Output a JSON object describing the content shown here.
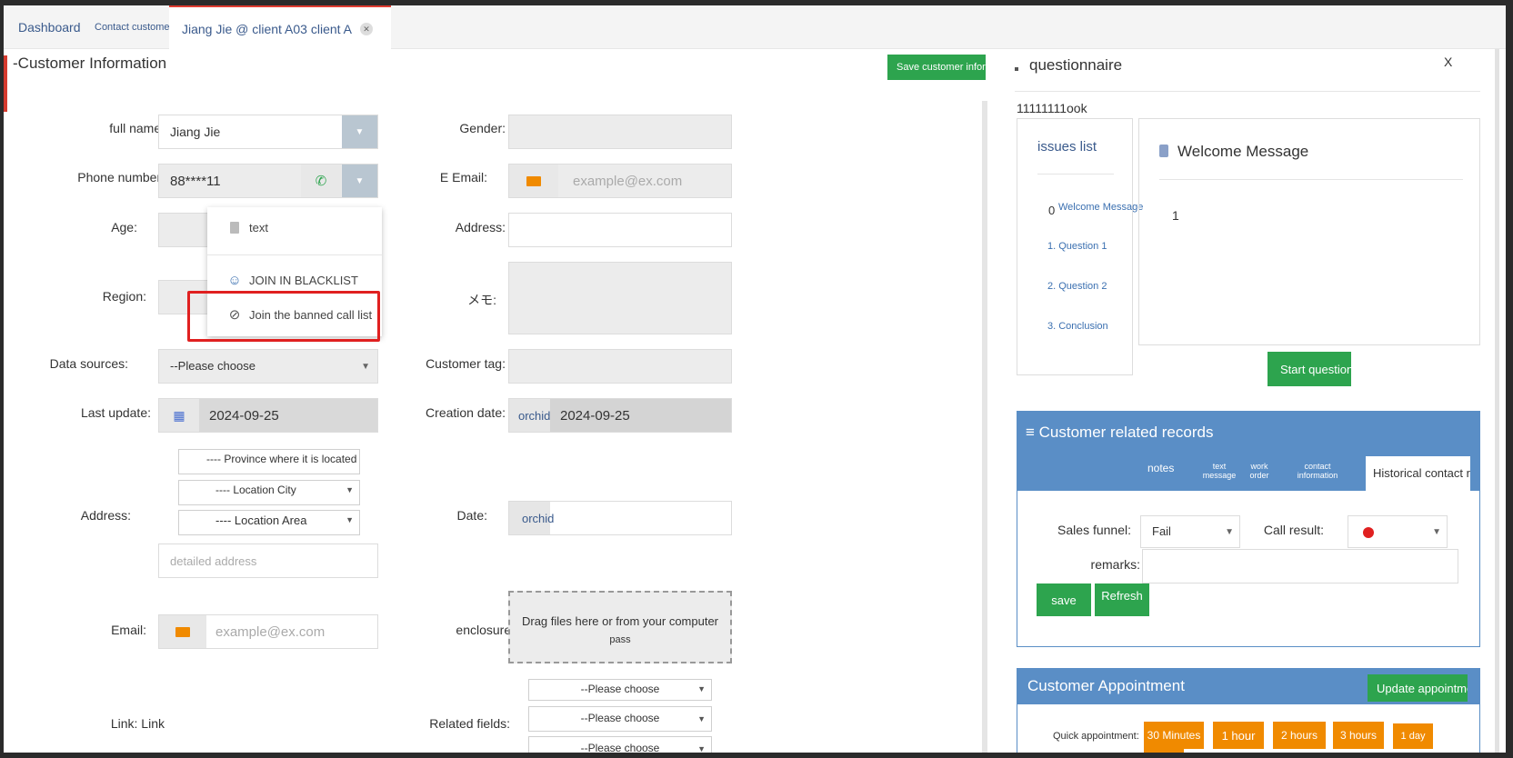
{
  "tabs": [
    {
      "label": "Dashboard"
    },
    {
      "label": "Contact customers"
    },
    {
      "label": "Jiang Jie @ client A03 client A"
    }
  ],
  "customer_info": {
    "title": "-Customer Information",
    "save_button": "Save customer information",
    "full_name": {
      "label": "full name:",
      "value": "Jiang Jie"
    },
    "phone": {
      "label": "Phone number:",
      "value": "88****11"
    },
    "age": {
      "label": "Age:"
    },
    "region": {
      "label": "Region:"
    },
    "data_sources": {
      "label": "Data sources:",
      "value": "--Please choose"
    },
    "last_update": {
      "label": "Last update:",
      "value": "2024-09-25"
    },
    "address": {
      "label": "Address:",
      "province": "---- Province where it is located",
      "city": "---- Location City",
      "area": "---- Location Area",
      "detail_placeholder": "detailed address"
    },
    "email": {
      "label": "Email:",
      "placeholder": "example@ex.com"
    },
    "link": {
      "label": "Link: Link"
    },
    "gender": {
      "label": "Gender:"
    },
    "e_email": {
      "label": "E Email:",
      "placeholder": "example@ex.com"
    },
    "address2": {
      "label": "Address:"
    },
    "memo": {
      "label": "メモ:"
    },
    "customer_tag": {
      "label": "Customer tag:"
    },
    "creation_date": {
      "label": "Creation date:",
      "prefix": "orchid",
      "value": "2024-09-25"
    },
    "date": {
      "label": "Date:",
      "prefix": "orchid"
    },
    "enclosure": {
      "label": "enclosure:",
      "drop_text": "Drag files here or from your computer",
      "drop_sub": "pass"
    },
    "related_fields": {
      "label": "Related fields:",
      "options": [
        "--Please choose",
        "--Please choose",
        "--Please choose"
      ]
    }
  },
  "phone_dropdown": {
    "items": [
      {
        "label": "text",
        "icon": "document-icon"
      },
      {
        "label": "JOIN IN BLACKLIST",
        "icon": "smiley-icon"
      },
      {
        "label": "Join the banned call list",
        "icon": "ban-icon"
      }
    ]
  },
  "questionnaire": {
    "title": "questionnaire",
    "close": "X",
    "name": "11111111ook",
    "issues_title": "issues list",
    "issues": [
      {
        "num": "0",
        "label": "Welcome Message"
      },
      {
        "num": "",
        "label": "1. Question 1"
      },
      {
        "num": "",
        "label": "2. Question 2"
      },
      {
        "num": "",
        "label": "3. Conclusion"
      }
    ],
    "content_title": "Welcome Message",
    "content_body": "1",
    "start_button": "Start questionnaire"
  },
  "records": {
    "title": "≡ Customer related records",
    "tabs": [
      "notes",
      "text message",
      "work order",
      "contact information",
      "Historical contact records"
    ],
    "sales_funnel": {
      "label": "Sales funnel:",
      "value": "Fail"
    },
    "call_result": {
      "label": "Call result:"
    },
    "remarks": {
      "label": "remarks:"
    },
    "save_button": "save",
    "refresh_button": "Refresh"
  },
  "appointment": {
    "title": "Customer Appointment",
    "update_button": "Update appointment time",
    "quick_label": "Quick appointment:",
    "quick_options": [
      "30 Minutes",
      "1 hour",
      "2 hours",
      "3 hours",
      "1 day"
    ]
  },
  "colors": {
    "accent_green": "#2da44e",
    "accent_orange": "#f08a00",
    "header_blue": "#5a8ec6",
    "highlight_red": "#e02020"
  }
}
